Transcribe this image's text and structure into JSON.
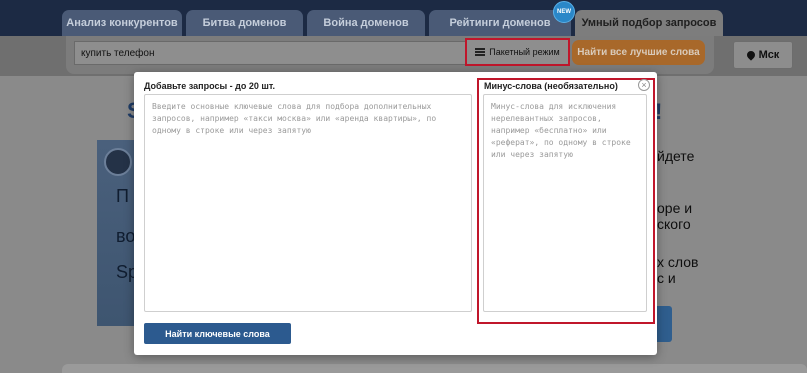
{
  "nav": {
    "tabs": [
      {
        "label": "Анализ конкурентов"
      },
      {
        "label": "Битва доменов"
      },
      {
        "label": "Война доменов"
      },
      {
        "label": "Рейтинги доменов",
        "badge": "NEW"
      },
      {
        "label": "Умный подбор запросов",
        "active": true
      }
    ]
  },
  "toolbar": {
    "search_value": "купить телефон",
    "batch_mode_label": "Пакетный режим",
    "find_best_label": "Найти все лучшие слова",
    "city_label": "Мск"
  },
  "modal": {
    "queries_label": "Добавьте запросы - до 20 шт.",
    "queries_placeholder": "Введите основные ключевые слова для подбора дополнительных запросов, например «такси москва» или «аренда квартиры», по одному в строке или через запятую",
    "minus_label": "Минус-слова (необязательно)",
    "minus_placeholder": "Минус-слова для исключения нерелевантных запросов, например «бесплатно» или «реферат», по одному в строке или через запятую",
    "close_icon": "×",
    "submit_label": "Найти ключевые слова"
  },
  "background": {
    "left_lines": [
      "П",
      "во",
      "Sp"
    ],
    "right_lines": [
      "йдете",
      "оре и",
      "ского",
      "х слов",
      "с и"
    ]
  },
  "colors": {
    "nav_bg": "#1c2a44",
    "highlight_border": "#c0162b",
    "primary_button": "#2c5a8f",
    "accent_button": "#f09a3e"
  }
}
